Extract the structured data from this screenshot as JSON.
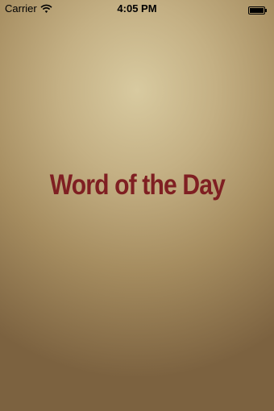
{
  "status_bar": {
    "carrier": "Carrier",
    "time": "4:05 PM",
    "wifi_icon": "wifi-icon",
    "battery_icon": "battery-icon"
  },
  "splash": {
    "title": "Word of the Day",
    "title_color": "#7f1f22",
    "background_color": "#c4b084"
  }
}
